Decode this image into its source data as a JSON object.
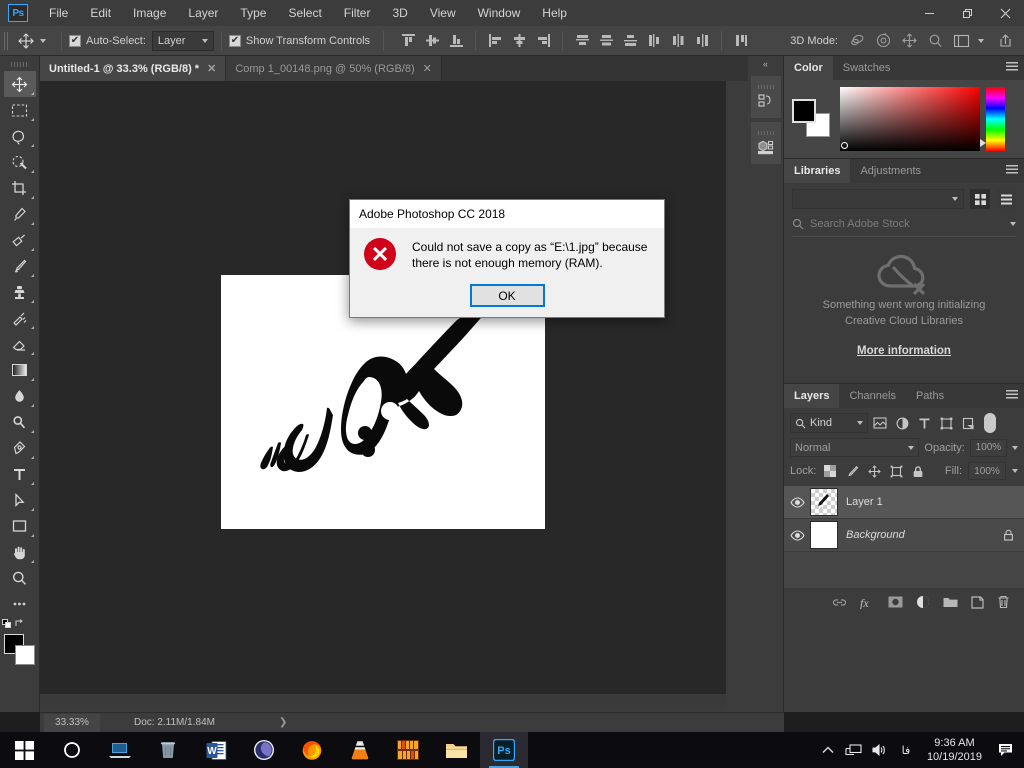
{
  "window": {
    "app_logo": "ps-logo",
    "menus": [
      "File",
      "Edit",
      "Image",
      "Layer",
      "Type",
      "Select",
      "Filter",
      "3D",
      "View",
      "Window",
      "Help"
    ],
    "controls": {
      "minimize": "—",
      "restore": "❐",
      "close": "✕"
    }
  },
  "options_bar": {
    "auto_select_label": "Auto-Select:",
    "auto_select_checked": "✔",
    "layer_select_value": "Layer",
    "show_transform_label": "Show Transform Controls",
    "show_transform_checked": "✔",
    "mode3d_label": "3D Mode:",
    "align_icons": [
      "align-top-edges-icon",
      "align-vertical-centers-icon",
      "align-bottom-edges-icon",
      "align-left-edges-icon",
      "align-horizontal-centers-icon",
      "align-right-edges-icon"
    ],
    "distribute_icons": [
      "distribute-top-edges-icon",
      "distribute-vertical-centers-icon",
      "distribute-bottom-edges-icon",
      "distribute-left-edges-icon",
      "distribute-horizontal-centers-icon",
      "distribute-right-edges-icon"
    ],
    "mode3d_icons": [
      "orbit-3d-icon",
      "roll-3d-icon",
      "pan-3d-icon",
      "zoom-3d-icon"
    ]
  },
  "tabs": [
    {
      "label": "Untitled-1 @ 33.3% (RGB/8) *",
      "active": true,
      "close": "✕"
    },
    {
      "label": "Comp 1_00148.png @ 50% (RGB/8)",
      "active": false,
      "close": "✕"
    }
  ],
  "tools": [
    {
      "name": "move-tool",
      "selected": true
    },
    {
      "name": "rectangular-marquee-tool",
      "selected": false
    },
    {
      "name": "lasso-tool",
      "selected": false
    },
    {
      "name": "quick-selection-tool",
      "selected": false
    },
    {
      "name": "crop-tool",
      "selected": false
    },
    {
      "name": "eyedropper-tool",
      "selected": false
    },
    {
      "name": "spot-healing-brush-tool",
      "selected": false
    },
    {
      "name": "brush-tool",
      "selected": false
    },
    {
      "name": "clone-stamp-tool",
      "selected": false
    },
    {
      "name": "history-brush-tool",
      "selected": false
    },
    {
      "name": "eraser-tool",
      "selected": false
    },
    {
      "name": "gradient-tool",
      "selected": false
    },
    {
      "name": "blur-tool",
      "selected": false
    },
    {
      "name": "dodge-tool",
      "selected": false
    },
    {
      "name": "pen-tool",
      "selected": false
    },
    {
      "name": "type-tool",
      "selected": false
    },
    {
      "name": "path-selection-tool",
      "selected": false
    },
    {
      "name": "rectangle-tool",
      "selected": false
    },
    {
      "name": "hand-tool",
      "selected": false
    },
    {
      "name": "zoom-tool",
      "selected": false
    },
    {
      "name": "edit-toolbar-tool",
      "selected": false
    }
  ],
  "colors": {
    "foreground": "#000000",
    "background": "#ffffff",
    "accent": "#31a8ff",
    "error_red": "#d0021b",
    "focus_blue": "#0078d7"
  },
  "canvas": {
    "artwork_alt": "persian-calligraphy-goftar-ma"
  },
  "status_bar": {
    "zoom": "33.33%",
    "doc_info": "Doc: 2.11M/1.84M",
    "expander": "❯"
  },
  "color_panel": {
    "tabs": [
      {
        "label": "Color",
        "active": true
      },
      {
        "label": "Swatches",
        "active": false
      }
    ]
  },
  "libraries_panel": {
    "tabs": [
      {
        "label": "Libraries",
        "active": true
      },
      {
        "label": "Adjustments",
        "active": false
      }
    ],
    "library_select_value": "",
    "search_placeholder": "Search Adobe Stock",
    "error_line1": "Something went wrong initializing",
    "error_line2": "Creative Cloud Libraries",
    "more_info_link": "More information",
    "view_grid": "grid-view-icon",
    "view_list": "list-view-icon"
  },
  "layers_panel": {
    "tabs": [
      {
        "label": "Layers",
        "active": true
      },
      {
        "label": "Channels",
        "active": false
      },
      {
        "label": "Paths",
        "active": false
      }
    ],
    "kind_filter": "Kind",
    "filter_icons": [
      "filter-pixel-icon",
      "filter-adjustment-icon",
      "filter-type-icon",
      "filter-shape-icon",
      "filter-smart-object-icon"
    ],
    "blend_mode": "Normal",
    "opacity_label": "Opacity:",
    "opacity_value": "100%",
    "lock_label": "Lock:",
    "lock_icons": [
      "lock-transparent-pixels-icon",
      "lock-image-pixels-icon",
      "lock-position-icon",
      "lock-artboard-icon",
      "lock-all-icon"
    ],
    "fill_label": "Fill:",
    "fill_value": "100%",
    "layers": [
      {
        "name": "Layer 1",
        "visible": true,
        "selected": true,
        "italic": false,
        "locked": false,
        "thumb": "checker"
      },
      {
        "name": "Background",
        "visible": true,
        "selected": false,
        "italic": true,
        "locked": true,
        "thumb": "white"
      }
    ],
    "footer_icons": [
      "link-layers-icon",
      "layer-style-fx-icon",
      "add-layer-mask-icon",
      "new-adjustment-layer-icon",
      "new-group-icon",
      "new-layer-icon",
      "delete-layer-icon"
    ]
  },
  "dock_strip": {
    "collapse": "«",
    "buttons": [
      "history-panel-icon",
      "3d-panel-icon"
    ]
  },
  "dialog": {
    "title": "Adobe Photoshop CC 2018",
    "message": "Could not save a copy as “E:\\1.jpg” because there is not enough memory (RAM).",
    "ok_label": "OK",
    "icon": "error-icon"
  },
  "taskbar": {
    "items": [
      {
        "name": "start-button",
        "active": false,
        "running": false
      },
      {
        "name": "cortana-search-icon",
        "active": false,
        "running": false
      },
      {
        "name": "task-view-icon",
        "active": false,
        "running": false
      },
      {
        "name": "recycle-bin-icon",
        "active": false,
        "running": false
      },
      {
        "name": "microsoft-word-icon",
        "active": false,
        "running": false
      },
      {
        "name": "cinema-4d-icon",
        "active": false,
        "running": false
      },
      {
        "name": "firefox-icon",
        "active": false,
        "running": true
      },
      {
        "name": "vlc-media-player-icon",
        "active": false,
        "running": true
      },
      {
        "name": "bookshelf-app-icon",
        "active": false,
        "running": true
      },
      {
        "name": "file-explorer-icon",
        "active": false,
        "running": true
      },
      {
        "name": "photoshop-icon",
        "active": true,
        "running": true
      }
    ],
    "tray": {
      "show_hidden": "show-hidden-icons-icon",
      "network": "network-icon",
      "volume": "volume-icon",
      "language": "فا",
      "time": "9:36 AM",
      "date": "10/19/2019",
      "action_center": "action-center-icon"
    }
  }
}
